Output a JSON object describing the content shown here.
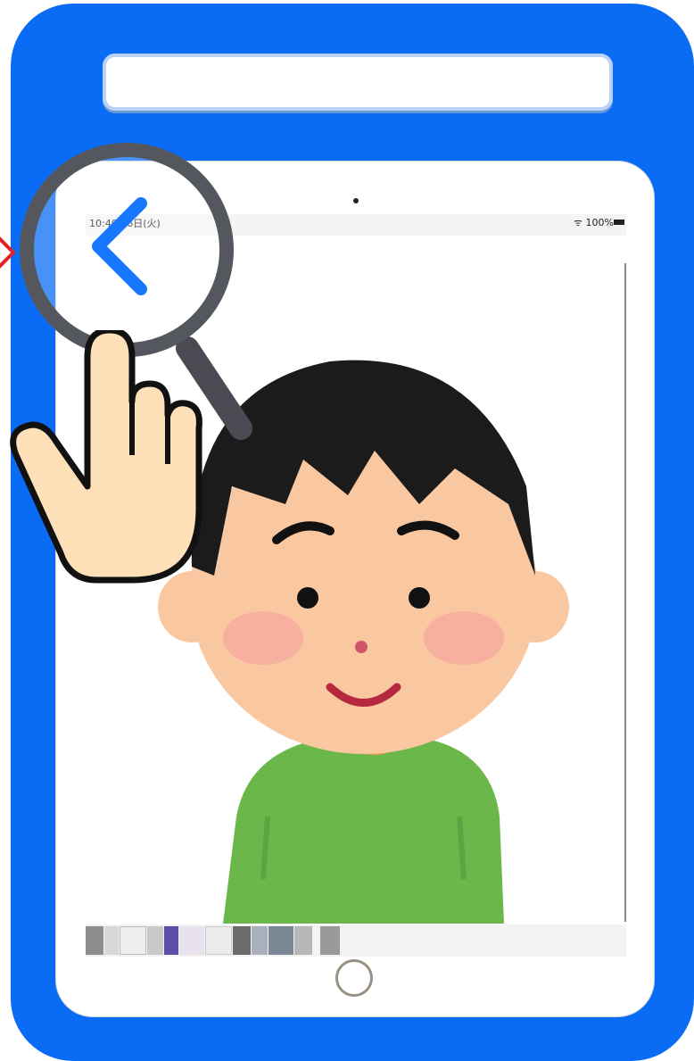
{
  "statusbar": {
    "time_date": "10:40  16日(火)",
    "battery": "100%"
  },
  "icons": {
    "back": "chevron-left-icon",
    "home": "home-button",
    "magnifier": "magnifier-icon",
    "pointer": "pointing-hand-icon"
  },
  "colors": {
    "frame": "#0a6cf5",
    "accent": "#1677ff"
  },
  "thumbnails_count": 12
}
